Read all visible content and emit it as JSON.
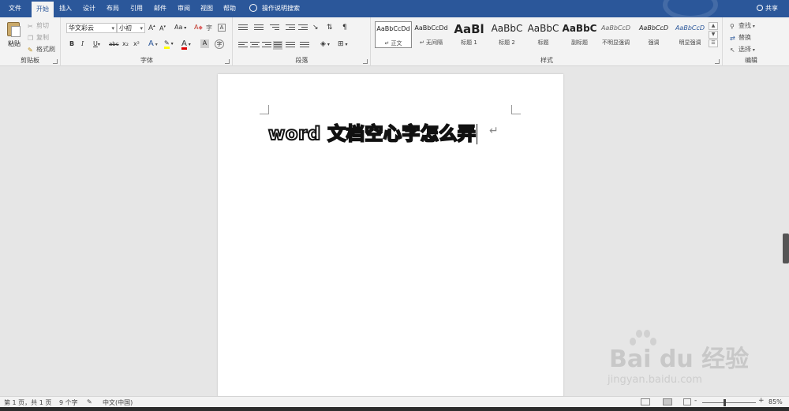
{
  "tabs": [
    {
      "label": "文件"
    },
    {
      "label": "开始"
    },
    {
      "label": "插入"
    },
    {
      "label": "设计"
    },
    {
      "label": "布局"
    },
    {
      "label": "引用"
    },
    {
      "label": "邮件"
    },
    {
      "label": "审阅"
    },
    {
      "label": "视图"
    },
    {
      "label": "帮助"
    }
  ],
  "tell_me": "操作说明搜索",
  "share": "共享",
  "clipboard": {
    "paste": "粘贴",
    "cut": "剪切",
    "copy": "复制",
    "format_painter": "格式刷",
    "label": "剪贴板"
  },
  "font": {
    "name": "华文彩云",
    "size": "小初",
    "grow": "A",
    "shrink": "A",
    "change_case": "Aa",
    "clear": "A",
    "char_border": "A",
    "bold": "B",
    "italic": "I",
    "underline": "U",
    "strike": "abc",
    "subscript": "x₂",
    "superscript": "x²",
    "effects": "A",
    "highlight": "ab",
    "color": "A",
    "shading": "A",
    "enclose": "字",
    "label": "字体"
  },
  "paragraph": {
    "label": "段落"
  },
  "styles": {
    "label": "样式",
    "items": [
      {
        "preview": "AaBbCcDd",
        "name": "正文"
      },
      {
        "preview": "AaBbCcDd",
        "name": "无间隔"
      },
      {
        "preview": "AaBl",
        "name": "标题 1"
      },
      {
        "preview": "AaBbC",
        "name": "标题 2"
      },
      {
        "preview": "AaBbC",
        "name": "标题"
      },
      {
        "preview": "AaBbC",
        "name": "副标题"
      },
      {
        "preview": "AaBbCcD",
        "name": "不明显强调"
      },
      {
        "preview": "AaBbCcD",
        "name": "强调"
      },
      {
        "preview": "AaBbCcD",
        "name": "明显强调"
      }
    ]
  },
  "editing": {
    "find": "查找",
    "replace": "替换",
    "select": "选择",
    "label": "编辑"
  },
  "document": {
    "text": "word 文档空心字怎么弄",
    "para_mark": "↵"
  },
  "watermark": {
    "logo": "Bai du 经验",
    "url": "jingyan.baidu.com"
  },
  "status": {
    "page": "第 1 页，共 1 页",
    "words": "9 个字",
    "language": "中文(中国)",
    "zoom_minus": "-",
    "zoom_plus": "+",
    "zoom": "85%",
    "zoom_level": 85
  },
  "colors": {
    "brand": "#2b579a",
    "highlight": "#ffff00",
    "font_color": "#e00000"
  }
}
